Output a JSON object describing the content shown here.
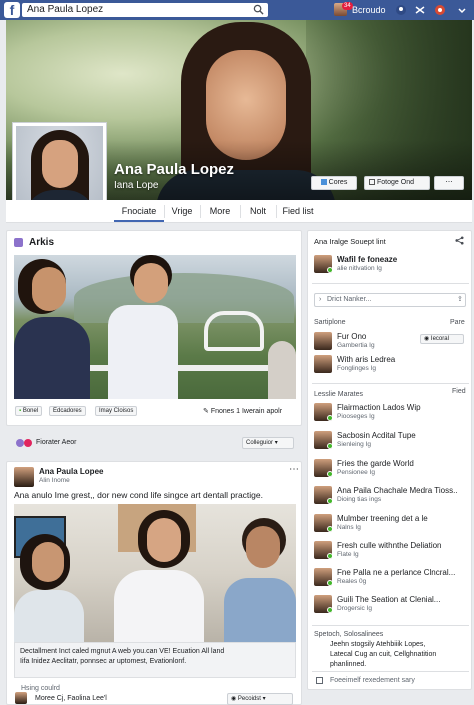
{
  "topbar": {
    "logo": "f",
    "search_value": "Ana Paula Lopez",
    "notif_count": "34",
    "user_label": "Bcroudo"
  },
  "profile": {
    "name": "Ana Paula Lopez",
    "subname": "Iana Lope",
    "cover_buttons": [
      "Cores",
      "Fotoge",
      "Ond"
    ]
  },
  "tabs": [
    "Fnociate",
    "Vrige",
    "More",
    "Nolt",
    "Fied list"
  ],
  "left_card": {
    "title": "Arkis",
    "buttons": [
      "Bonel",
      "Edcadores",
      "Imay Cloisos"
    ],
    "right_text": "Fnones 1 Iwerain apolr"
  },
  "reaction_row": {
    "text": "Fiorater Aeor",
    "button": "Colleguior"
  },
  "post": {
    "author": "Ana Paula Lopee",
    "meta": "Alin Inome",
    "text": "Ana anulo Ime grest,, dor new cond life singce art dentall practige.",
    "caption_line1": "Dectallment Inct caled mgnut A web you.can VE! Ecuation All land",
    "caption_line2": "Iifa Inidez Aeclitatr, ponnsec ar uptomest, Evationlonf.",
    "more": "Hsing coulrd",
    "footer_left": "Moree Cj, Faolina Lee'l",
    "footer_button": "Pecoidst"
  },
  "right_card": {
    "header": "Ana Iralge Souept lint",
    "featured": {
      "title": "Wafil fe foneaze",
      "sub": "alie nitlvation Ig"
    },
    "search_placeholder": "Drict Nanker...",
    "section1_left": "Sartiplone",
    "section1_right": "Pare",
    "friends1": [
      {
        "title": "Fur Ono",
        "sub": "Gambertia Ig",
        "button": "Iecoral"
      },
      {
        "title": "With aris Ledrea",
        "sub": "Fonglinges Ig",
        "button": ""
      }
    ],
    "section2_left": "Lesslie Marates",
    "section2_right": "Fied",
    "friends2": [
      {
        "title": "Flairmaction Lados Wip",
        "sub": "Piooseges Ig"
      },
      {
        "title": "Sacbosin Acdital Tupe",
        "sub": "Sienleing Ig"
      },
      {
        "title": "Fries the garde World",
        "sub": "Pensionee Ig"
      },
      {
        "title": "Ana Paila Chachale Medra Tioss..",
        "sub": "Dioing tias ings"
      },
      {
        "title": "Mulmber treening det a le",
        "sub": "Nalns Ig"
      },
      {
        "title": "Fresh culle withnthe Deliation",
        "sub": "Flate Ig"
      },
      {
        "title": "Fne Palla ne a perlance Clncral...",
        "sub": "Reales 0g"
      },
      {
        "title": "Guili The Seation at Clenial...",
        "sub": "Drogersic Ig"
      }
    ],
    "section3_label": "Spetoch, Solosalinees",
    "section3_text1": "Jeehn stogsily Atehbiiik Lopes,",
    "section3_text2": "Latecal Cug an cuit, Cellghnatition",
    "section3_text3": "phanlinned.",
    "footer": "Foeeimelf rexedement sary"
  },
  "colors": {
    "topbar": "#3b5998",
    "accent": "#4267b2",
    "online": "#42b72a",
    "badge": "#e41e3f"
  }
}
